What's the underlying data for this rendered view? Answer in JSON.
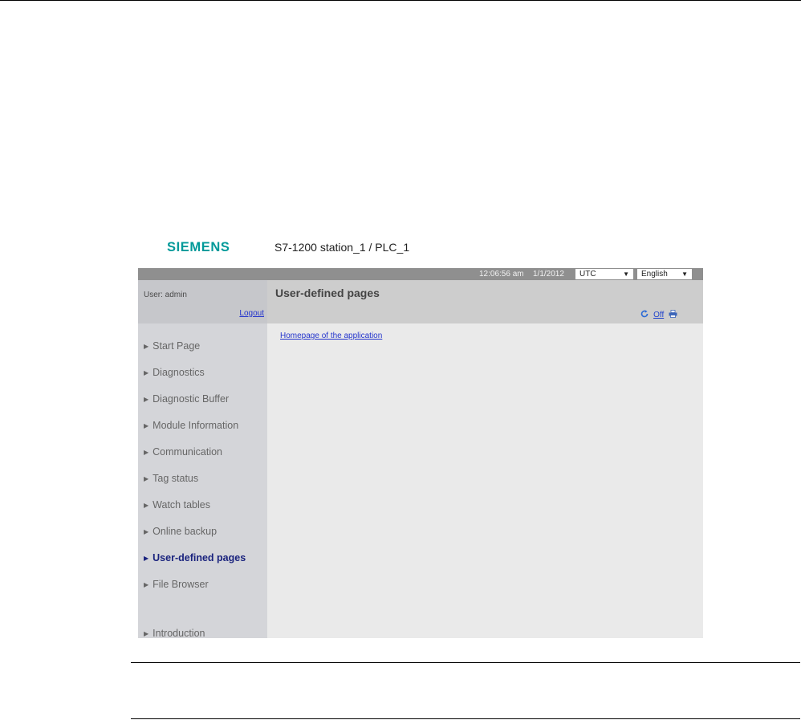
{
  "header": {
    "logo": "SIEMENS",
    "station": "S7-1200 station_1 / PLC_1"
  },
  "topbar": {
    "time": "12:06:56 am",
    "date": "1/1/2012",
    "timezone": "UTC",
    "language": "English",
    "dropdown_arrow": "▼"
  },
  "user": {
    "label": "User: admin",
    "logout": "Logout"
  },
  "sidebar": {
    "marker": "▶",
    "items": [
      {
        "label": "Start Page"
      },
      {
        "label": "Diagnostics"
      },
      {
        "label": "Diagnostic Buffer"
      },
      {
        "label": "Module Information"
      },
      {
        "label": "Communication"
      },
      {
        "label": "Tag status"
      },
      {
        "label": "Watch tables"
      },
      {
        "label": "Online backup"
      },
      {
        "label": "User-defined pages",
        "active": true
      },
      {
        "label": "File Browser"
      },
      {
        "label": "Introduction"
      }
    ]
  },
  "main": {
    "title": "User-defined pages",
    "refresh_icon": "refresh-icon",
    "refresh_label": "Off",
    "print_icon": "print-icon",
    "link": "Homepage of the application"
  },
  "colors": {
    "logo": "#009999",
    "link": "#2233cc",
    "active_nav": "#1a237e"
  }
}
